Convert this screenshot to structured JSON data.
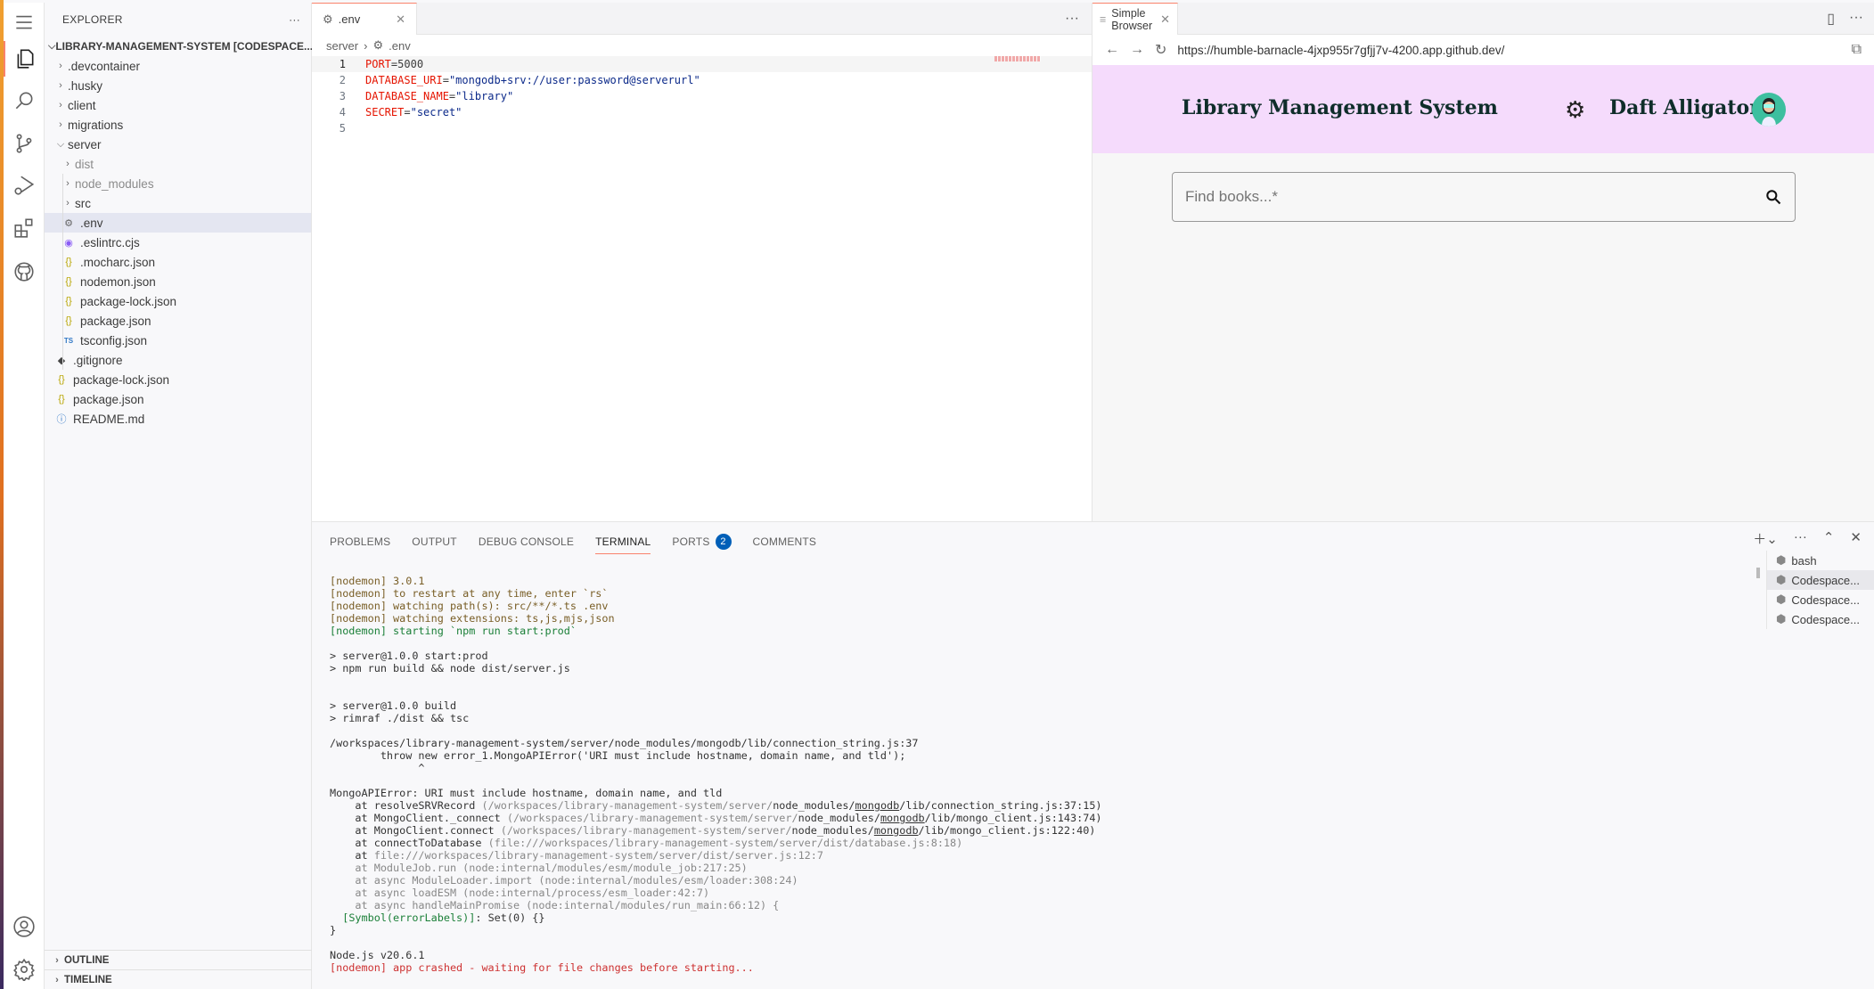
{
  "activity_bar": {
    "items": [
      "menu-icon",
      "files-icon",
      "search-icon",
      "source-control-icon",
      "run-debug-icon",
      "extensions-icon",
      "github-icon"
    ],
    "bottom": [
      "account-icon",
      "settings-gear-icon"
    ]
  },
  "explorer": {
    "title": "EXPLORER",
    "more": "···",
    "root": "LIBRARY-MANAGEMENT-SYSTEM [CODESPACE...",
    "items": [
      {
        "label": ".devcontainer",
        "type": "folder",
        "depth": 1
      },
      {
        "label": ".husky",
        "type": "folder",
        "depth": 1
      },
      {
        "label": "client",
        "type": "folder",
        "depth": 1
      },
      {
        "label": "migrations",
        "type": "folder",
        "depth": 1
      },
      {
        "label": "server",
        "type": "folder-open",
        "depth": 1
      },
      {
        "label": "dist",
        "type": "folder",
        "depth": 2,
        "dim": true
      },
      {
        "label": "node_modules",
        "type": "folder",
        "depth": 2,
        "dim": true
      },
      {
        "label": "src",
        "type": "folder",
        "depth": 2
      },
      {
        "label": ".env",
        "type": "gear",
        "depth": 2,
        "selected": true
      },
      {
        "label": ".eslintrc.cjs",
        "type": "eslint",
        "depth": 2
      },
      {
        "label": ".mocharc.json",
        "type": "json",
        "depth": 2
      },
      {
        "label": "nodemon.json",
        "type": "json",
        "depth": 2
      },
      {
        "label": "package-lock.json",
        "type": "json",
        "depth": 2
      },
      {
        "label": "package.json",
        "type": "json",
        "depth": 2
      },
      {
        "label": "tsconfig.json",
        "type": "ts",
        "depth": 2
      },
      {
        "label": ".gitignore",
        "type": "git",
        "depth": 1
      },
      {
        "label": "package-lock.json",
        "type": "json",
        "depth": 1
      },
      {
        "label": "package.json",
        "type": "json",
        "depth": 1
      },
      {
        "label": "README.md",
        "type": "info",
        "depth": 1
      }
    ],
    "outline": "OUTLINE",
    "timeline": "TIMELINE"
  },
  "editor": {
    "tab": ".env",
    "more": "···",
    "breadcrumb": [
      "server",
      ".env"
    ],
    "lines": [
      {
        "n": "1",
        "key": "PORT",
        "eq": "=",
        "val": "5000"
      },
      {
        "n": "2",
        "key": "DATABASE_URI",
        "eq": "=",
        "val": "\"mongodb+srv://user:password@serverurl\""
      },
      {
        "n": "3",
        "key": "DATABASE_NAME",
        "eq": "=",
        "val": "\"library\""
      },
      {
        "n": "4",
        "key": "SECRET",
        "eq": "=",
        "val": "\"secret\""
      },
      {
        "n": "5",
        "key": "",
        "eq": "",
        "val": ""
      }
    ]
  },
  "browser": {
    "tab": "Simple Browser",
    "url": "https://humble-barnacle-4jxp955r7gfjj7v-4200.app.github.dev/",
    "app_title": "Library Management System",
    "user_name": "Daft Alligator",
    "search_placeholder": "Find books...*",
    "header_color": "#f5dbfc"
  },
  "panel": {
    "tabs": [
      "PROBLEMS",
      "OUTPUT",
      "DEBUG CONSOLE",
      "TERMINAL",
      "PORTS",
      "COMMENTS"
    ],
    "active_tab": "TERMINAL",
    "ports_badge": "2",
    "terminals": [
      "bash",
      "Codespace...",
      "Codespace...",
      "Codespace..."
    ],
    "terminal_lines": [
      [
        {
          "t": "[nodemon] 3.0.1",
          "c": "yel"
        }
      ],
      [
        {
          "t": "[nodemon] to restart at any time, enter `rs`",
          "c": "yel"
        }
      ],
      [
        {
          "t": "[nodemon] watching path(s): src/**/*.ts .env",
          "c": "yel"
        }
      ],
      [
        {
          "t": "[nodemon] watching extensions: ts,js,mjs,json",
          "c": "yel"
        }
      ],
      [
        {
          "t": "[nodemon] starting `npm run start:prod`",
          "c": "grn"
        }
      ],
      [],
      [
        {
          "t": "> server@1.0.0 start:prod"
        }
      ],
      [
        {
          "t": "> npm run build && node dist/server.js"
        }
      ],
      [],
      [],
      [
        {
          "t": "> server@1.0.0 build"
        }
      ],
      [
        {
          "t": "> rimraf ./dist && tsc"
        }
      ],
      [],
      [
        {
          "t": "/workspaces/library-management-system/server/node_modules/mongodb/lib/connection_string.js:37"
        }
      ],
      [
        {
          "t": "        throw new error_1.MongoAPIError('URI must include hostname, domain name, and tld');"
        }
      ],
      [
        {
          "t": "              ^"
        }
      ],
      [],
      [
        {
          "t": "MongoAPIError: URI must include hostname, domain name, and tld"
        }
      ],
      [
        {
          "t": "    at resolveSRVRecord "
        },
        {
          "t": "(/workspaces/library-management-system/server/",
          "c": "gry"
        },
        {
          "t": "node_modules/"
        },
        {
          "t": "mongodb",
          "c": "ul"
        },
        {
          "t": "/lib/connection_string.js:37:15)"
        }
      ],
      [
        {
          "t": "    at MongoClient._connect "
        },
        {
          "t": "(/workspaces/library-management-system/server/",
          "c": "gry"
        },
        {
          "t": "node_modules/"
        },
        {
          "t": "mongodb",
          "c": "ul"
        },
        {
          "t": "/lib/mongo_client.js:143:74)"
        }
      ],
      [
        {
          "t": "    at MongoClient.connect "
        },
        {
          "t": "(/workspaces/library-management-system/server/",
          "c": "gry"
        },
        {
          "t": "node_modules/"
        },
        {
          "t": "mongodb",
          "c": "ul"
        },
        {
          "t": "/lib/mongo_client.js:122:40)"
        }
      ],
      [
        {
          "t": "    at connectToDatabase "
        },
        {
          "t": "(file:///workspaces/library-management-system/server/dist/database.js:8:18)",
          "c": "gry"
        }
      ],
      [
        {
          "t": "    at "
        },
        {
          "t": "file:///workspaces/library-management-system/server/dist/server.js:12:7",
          "c": "gry"
        }
      ],
      [
        {
          "t": "    at ModuleJob.run (node:internal/modules/esm/module_job:217:25)",
          "c": "gry"
        }
      ],
      [
        {
          "t": "    at async ModuleLoader.import (node:internal/modules/esm/loader:308:24)",
          "c": "gry"
        }
      ],
      [
        {
          "t": "    at async loadESM (node:internal/process/esm_loader:42:7)",
          "c": "gry"
        }
      ],
      [
        {
          "t": "    at async handleMainPromise (node:internal/modules/run_main:66:12) {",
          "c": "gry"
        }
      ],
      [
        {
          "t": "  "
        },
        {
          "t": "[Symbol(errorLabels)]",
          "c": "grn"
        },
        {
          "t": ": Set(0) {}"
        }
      ],
      [
        {
          "t": "}"
        }
      ],
      [],
      [
        {
          "t": "Node.js v20.6.1"
        }
      ],
      [
        {
          "t": "[nodemon] app crashed - waiting for file changes before starting...",
          "c": "red"
        }
      ]
    ]
  }
}
